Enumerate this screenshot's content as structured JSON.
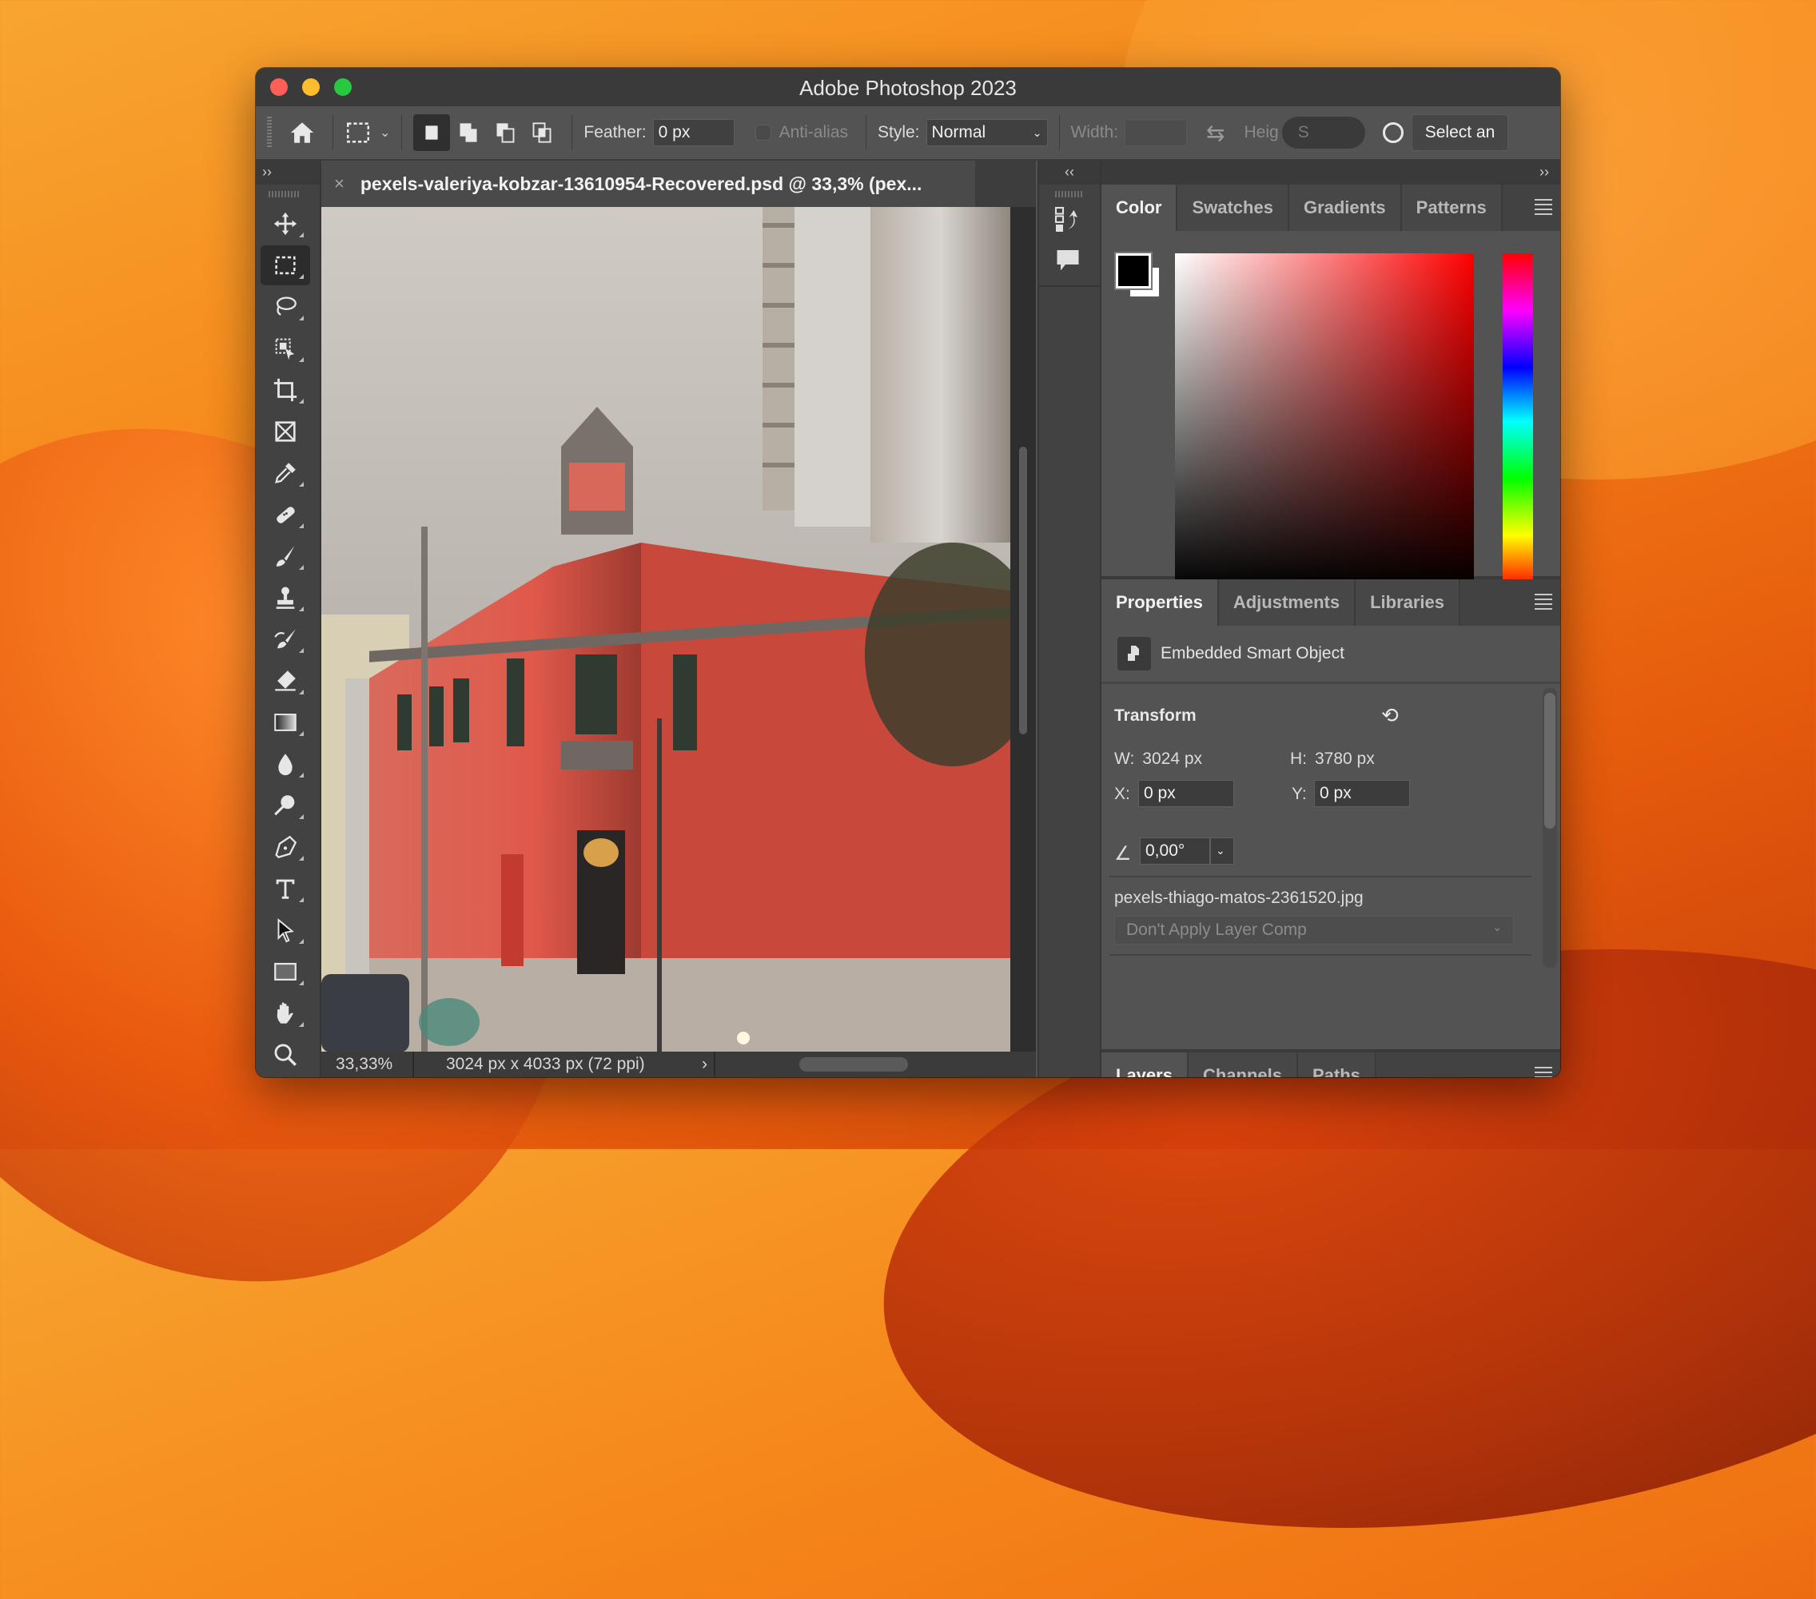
{
  "window": {
    "title": "Adobe Photoshop 2023"
  },
  "options_bar": {
    "feather_label": "Feather:",
    "feather_value": "0 px",
    "antialias_label": "Anti-alias",
    "style_label": "Style:",
    "style_value": "Normal",
    "width_label": "Width:",
    "width_value": "",
    "height_label": "Heig",
    "height_value": "S",
    "select_button": "Select an"
  },
  "left_strip": {
    "collapse_glyph": "››"
  },
  "document": {
    "tab_close": "×",
    "tab_title": "pexels-valeriya-kobzar-13610954-Recovered.psd @ 33,3% (pex...",
    "zoom": "33,33%",
    "info": "3024 px x 4033 px (72 ppi)",
    "info_arrow": "›"
  },
  "mid_strip": {
    "collapse_glyph": "‹‹"
  },
  "right_panel": {
    "collapse_glyph": "››",
    "color_tabs": [
      "Color",
      "Swatches",
      "Gradients",
      "Patterns"
    ],
    "color_active": "Color",
    "foreground": "#000000",
    "background": "#ffffff",
    "hue": "#ff0000",
    "props_tabs": [
      "Properties",
      "Adjustments",
      "Libraries"
    ],
    "smart_object_label": "Embedded Smart Object",
    "transform": {
      "heading": "Transform",
      "w_label": "W:",
      "w_value": "3024 px",
      "h_label": "H:",
      "h_value": "3780 px",
      "x_label": "X:",
      "x_value": "0 px",
      "y_label": "Y:",
      "y_value": "0 px",
      "angle_value": "0,00°"
    },
    "linked_file": "pexels-thiago-matos-2361520.jpg",
    "layer_comp": "Don't Apply Layer Comp",
    "layers_tabs": [
      "Layers",
      "Channels",
      "Paths"
    ]
  },
  "tools": [
    "move",
    "rectangular-marquee",
    "lasso",
    "object-selection",
    "crop",
    "frame",
    "eyedropper",
    "healing-brush",
    "brush",
    "clone-stamp",
    "history-brush",
    "eraser",
    "gradient",
    "blur",
    "dodge",
    "pen",
    "type",
    "path-selection",
    "rectangle",
    "hand",
    "zoom"
  ],
  "active_tool": "rectangular-marquee"
}
